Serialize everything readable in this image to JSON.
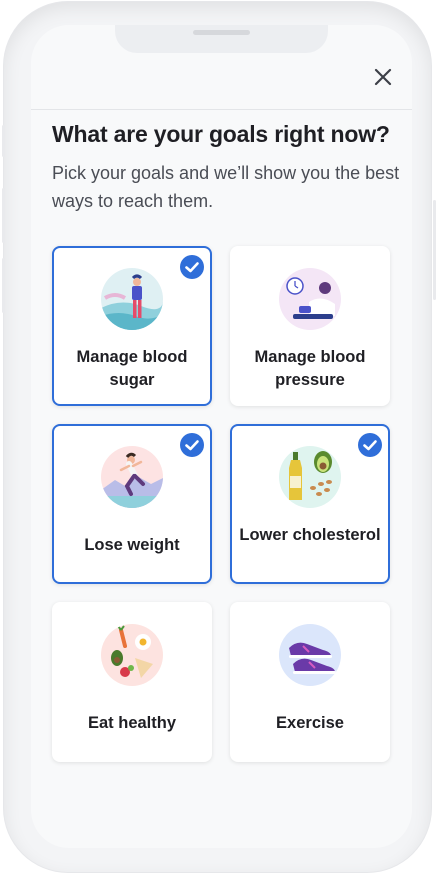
{
  "header": {
    "close_icon": "close-icon"
  },
  "title": "What are your goals right now?",
  "subtitle": "Pick your goals and we’ll show you the best ways to reach them.",
  "colors": {
    "accent": "#2f6ed9",
    "text": "#1f1f24",
    "muted": "#4a4d55"
  },
  "goals": [
    {
      "label": "Manage blood sugar",
      "selected": true,
      "icon": "person-standing-illustration"
    },
    {
      "label": "Manage blood pressure",
      "selected": false,
      "icon": "blood-pressure-cuff-illustration"
    },
    {
      "label": "Lose weight",
      "selected": true,
      "icon": "runner-illustration"
    },
    {
      "label": "Lower cholesterol",
      "selected": true,
      "icon": "olive-oil-avocado-illustration"
    },
    {
      "label": "Eat healthy",
      "selected": false,
      "icon": "healthy-plate-illustration"
    },
    {
      "label": "Exercise",
      "selected": false,
      "icon": "sneakers-illustration"
    }
  ]
}
